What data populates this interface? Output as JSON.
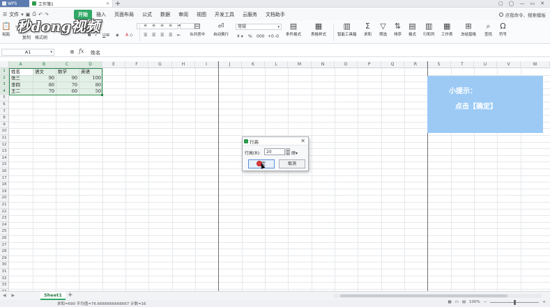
{
  "titlebar": {
    "app_name": "WPS",
    "doc_tab": "工作簿1",
    "new_tab": "+",
    "window_controls": [
      "▢",
      "◯",
      "—",
      "▭",
      "✕"
    ]
  },
  "menubar": {
    "file": "文件",
    "items": [
      "开始",
      "插入",
      "页面布局",
      "公式",
      "数据",
      "审阅",
      "视图",
      "开发工具",
      "云服务",
      "文档助手"
    ],
    "active_index": 0,
    "search": "点我命令、搜索模板"
  },
  "ribbon": {
    "paste": "粘贴",
    "copy": "复制",
    "format_painter": "格式刷",
    "font_size_placeholder": "",
    "merge_center": "合并居中",
    "auto_wrap": "自动换行",
    "number_format": "常规",
    "conditional_format": "条件格式",
    "table_style": "表格样式",
    "smart_toolbox": "智能工具箱",
    "sum": "求和",
    "filter": "筛选",
    "sort": "排序",
    "format": "格式",
    "row_col": "行和列",
    "worksheet": "工作表",
    "freeze": "冻结窗格",
    "find": "查找",
    "symbol": "符号"
  },
  "logo_text": "秒dong视频",
  "formula_bar": {
    "cell_ref": "A1",
    "fx": "fx",
    "content": "姓名"
  },
  "grid": {
    "columns": [
      "A",
      "B",
      "C",
      "D",
      "E",
      "F",
      "G",
      "H",
      "I",
      "J",
      "K",
      "L",
      "M",
      "N",
      "O",
      "P",
      "Q",
      "R",
      "S",
      "T",
      "U",
      "V",
      "W"
    ],
    "rows": [
      "1",
      "2",
      "3",
      "4",
      "5",
      "6",
      "7",
      "8",
      "9",
      "10",
      "11",
      "12",
      "13",
      "14",
      "15",
      "16",
      "17",
      "18",
      "19",
      "20",
      "21",
      "22",
      "23",
      "24",
      "25",
      "26",
      "27",
      "28",
      "29",
      "30",
      "31",
      "32",
      "33",
      "34"
    ],
    "table": [
      [
        "姓名",
        "语文",
        "数学",
        "英语"
      ],
      [
        "张三",
        "90",
        "90",
        "100"
      ],
      [
        "李四",
        "80",
        "70",
        "80"
      ],
      [
        "王二",
        "70",
        "60",
        "50"
      ]
    ]
  },
  "hint": {
    "line1": "小提示：",
    "line2": "点击【确定】"
  },
  "dialog": {
    "title": "行高",
    "label": "行高(R):",
    "value": "20",
    "unit": "磅",
    "ok": "确定",
    "cancel": "取消",
    "close": "✕"
  },
  "sheets": {
    "tabs": [
      "Sheet1"
    ],
    "add": "+",
    "nav": "◀ ▶"
  },
  "status": {
    "text": "求和=690  平均值=76.6666666666667  计数=16",
    "zoom": "100%"
  },
  "colors": {
    "accent_green": "#2fa866",
    "hint_bg": "#9ccaf5",
    "selection_border": "#2b8a4a"
  }
}
